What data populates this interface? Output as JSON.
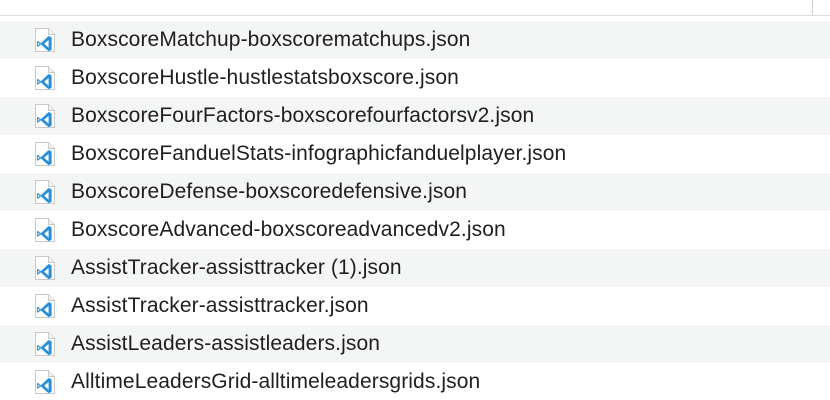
{
  "files": [
    {
      "name": "BoxscoreMatchup-boxscorematchups.json",
      "icon": "vscode-file-icon"
    },
    {
      "name": "BoxscoreHustle-hustlestatsboxscore.json",
      "icon": "vscode-file-icon"
    },
    {
      "name": "BoxscoreFourFactors-boxscorefourfactorsv2.json",
      "icon": "vscode-file-icon"
    },
    {
      "name": "BoxscoreFanduelStats-infographicfanduelplayer.json",
      "icon": "vscode-file-icon"
    },
    {
      "name": "BoxscoreDefense-boxscoredefensive.json",
      "icon": "vscode-file-icon"
    },
    {
      "name": "BoxscoreAdvanced-boxscoreadvancedv2.json",
      "icon": "vscode-file-icon"
    },
    {
      "name": "AssistTracker-assisttracker (1).json",
      "icon": "vscode-file-icon"
    },
    {
      "name": "AssistTracker-assisttracker.json",
      "icon": "vscode-file-icon"
    },
    {
      "name": "AssistLeaders-assistleaders.json",
      "icon": "vscode-file-icon"
    },
    {
      "name": "AlltimeLeadersGrid-alltimeleadersgrids.json",
      "icon": "vscode-file-icon"
    }
  ],
  "colors": {
    "row_stripe": "#f4f5f5",
    "text": "#1f1f1f",
    "icon_blue": "#2a8fd8"
  }
}
